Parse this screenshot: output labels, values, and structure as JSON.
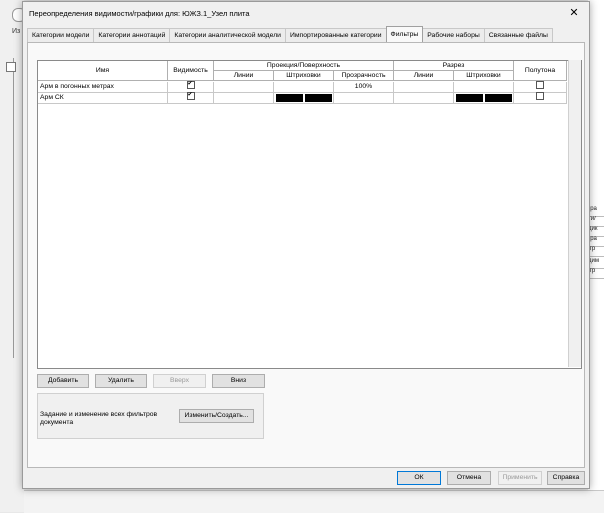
{
  "background": {
    "left_chars": "Из",
    "right_rows": [
      "гра",
      "ти/",
      "дик",
      "гра",
      "/гр",
      "дим",
      "/гр"
    ]
  },
  "dialog": {
    "title": "Переопределения видимости/графики для: ЮЖЗ.1_Узел плита",
    "close_glyph": "✕"
  },
  "tabs": [
    {
      "label": "Категории модели",
      "active": false
    },
    {
      "label": "Категории аннотаций",
      "active": false
    },
    {
      "label": "Категории аналитической модели",
      "active": false
    },
    {
      "label": "Импортированные категории",
      "active": false
    },
    {
      "label": "Фильтры",
      "active": true
    },
    {
      "label": "Рабочие наборы",
      "active": false
    },
    {
      "label": "Связанные файлы",
      "active": false
    }
  ],
  "grid": {
    "headers": {
      "name": "Имя",
      "visibility": "Видимость",
      "projection": "Проекция/Поверхность",
      "proj_lines": "Линии",
      "proj_patterns": "Штриховки",
      "proj_transparency": "Прозрачность",
      "cut": "Разрез",
      "cut_lines": "Линии",
      "cut_patterns": "Штриховки",
      "halftone": "Полутона"
    },
    "rows": [
      {
        "name": "Арм в погонных метрах",
        "visible": true,
        "proj_lines": "",
        "proj_patterns_black": false,
        "transparency": "100%",
        "cut_lines": "",
        "cut_patterns_black": false,
        "halftone": false
      },
      {
        "name": "Арм СК",
        "visible": true,
        "proj_lines": "",
        "proj_patterns_black": true,
        "transparency": "",
        "cut_lines": "",
        "cut_patterns_black": true,
        "halftone": false
      }
    ]
  },
  "buttons": {
    "add": "Добавить",
    "remove": "Удалить",
    "up": "Вверх",
    "down": "Вниз",
    "edit_create": "Изменить/Создать...",
    "ok": "ОК",
    "cancel": "Отмена",
    "apply": "Применить",
    "help": "Справка"
  },
  "filters_group_text": "Задание и изменение всех фильтров документа"
}
